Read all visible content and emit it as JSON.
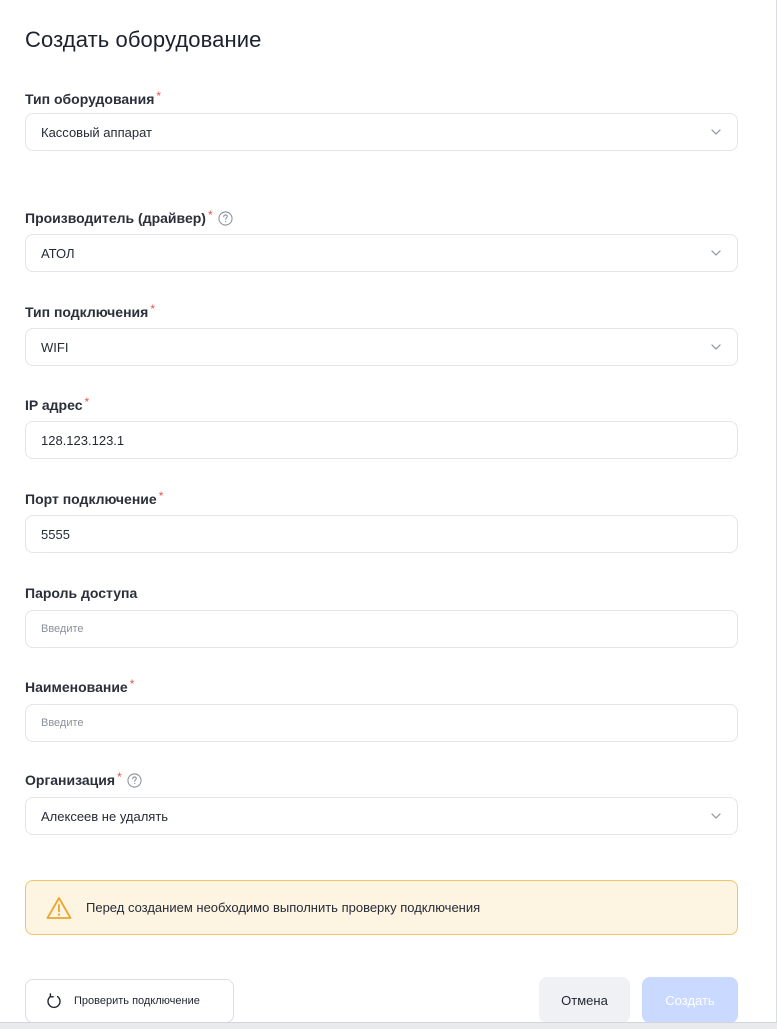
{
  "dialog": {
    "title": "Создать оборудование"
  },
  "required_mark": "*",
  "fields": {
    "equipment_type": {
      "label": "Тип оборудования",
      "value": "Кассовый аппарат"
    },
    "manufacturer": {
      "label": "Производитель (драйвер)",
      "value": "АТОЛ"
    },
    "connection_type": {
      "label": "Тип подключения",
      "value": "WIFI"
    },
    "ip_address": {
      "label": "IP адрес",
      "value": "128.123.123.1"
    },
    "port": {
      "label": "Порт подключение",
      "value": "5555"
    },
    "password": {
      "label": "Пароль доступа",
      "placeholder": "Введите"
    },
    "name": {
      "label": "Наименование",
      "placeholder": "Введите"
    },
    "organization": {
      "label": "Организация",
      "value": "Алексеев не удалять"
    }
  },
  "warning": {
    "text": "Перед созданием необходимо выполнить проверку подключения"
  },
  "buttons": {
    "check_connection": "Проверить подключение",
    "cancel": "Отмена",
    "create": "Создать"
  },
  "colors": {
    "required": "#e2574c",
    "warning_border": "#f2c56a",
    "warning_bg": "#fdf4e1",
    "create_disabled": "#c9d9ff"
  },
  "icons": {
    "help": "help-circle-icon",
    "chevron": "chevron-down-icon",
    "warning": "warning-triangle-icon",
    "refresh": "refresh-icon"
  }
}
